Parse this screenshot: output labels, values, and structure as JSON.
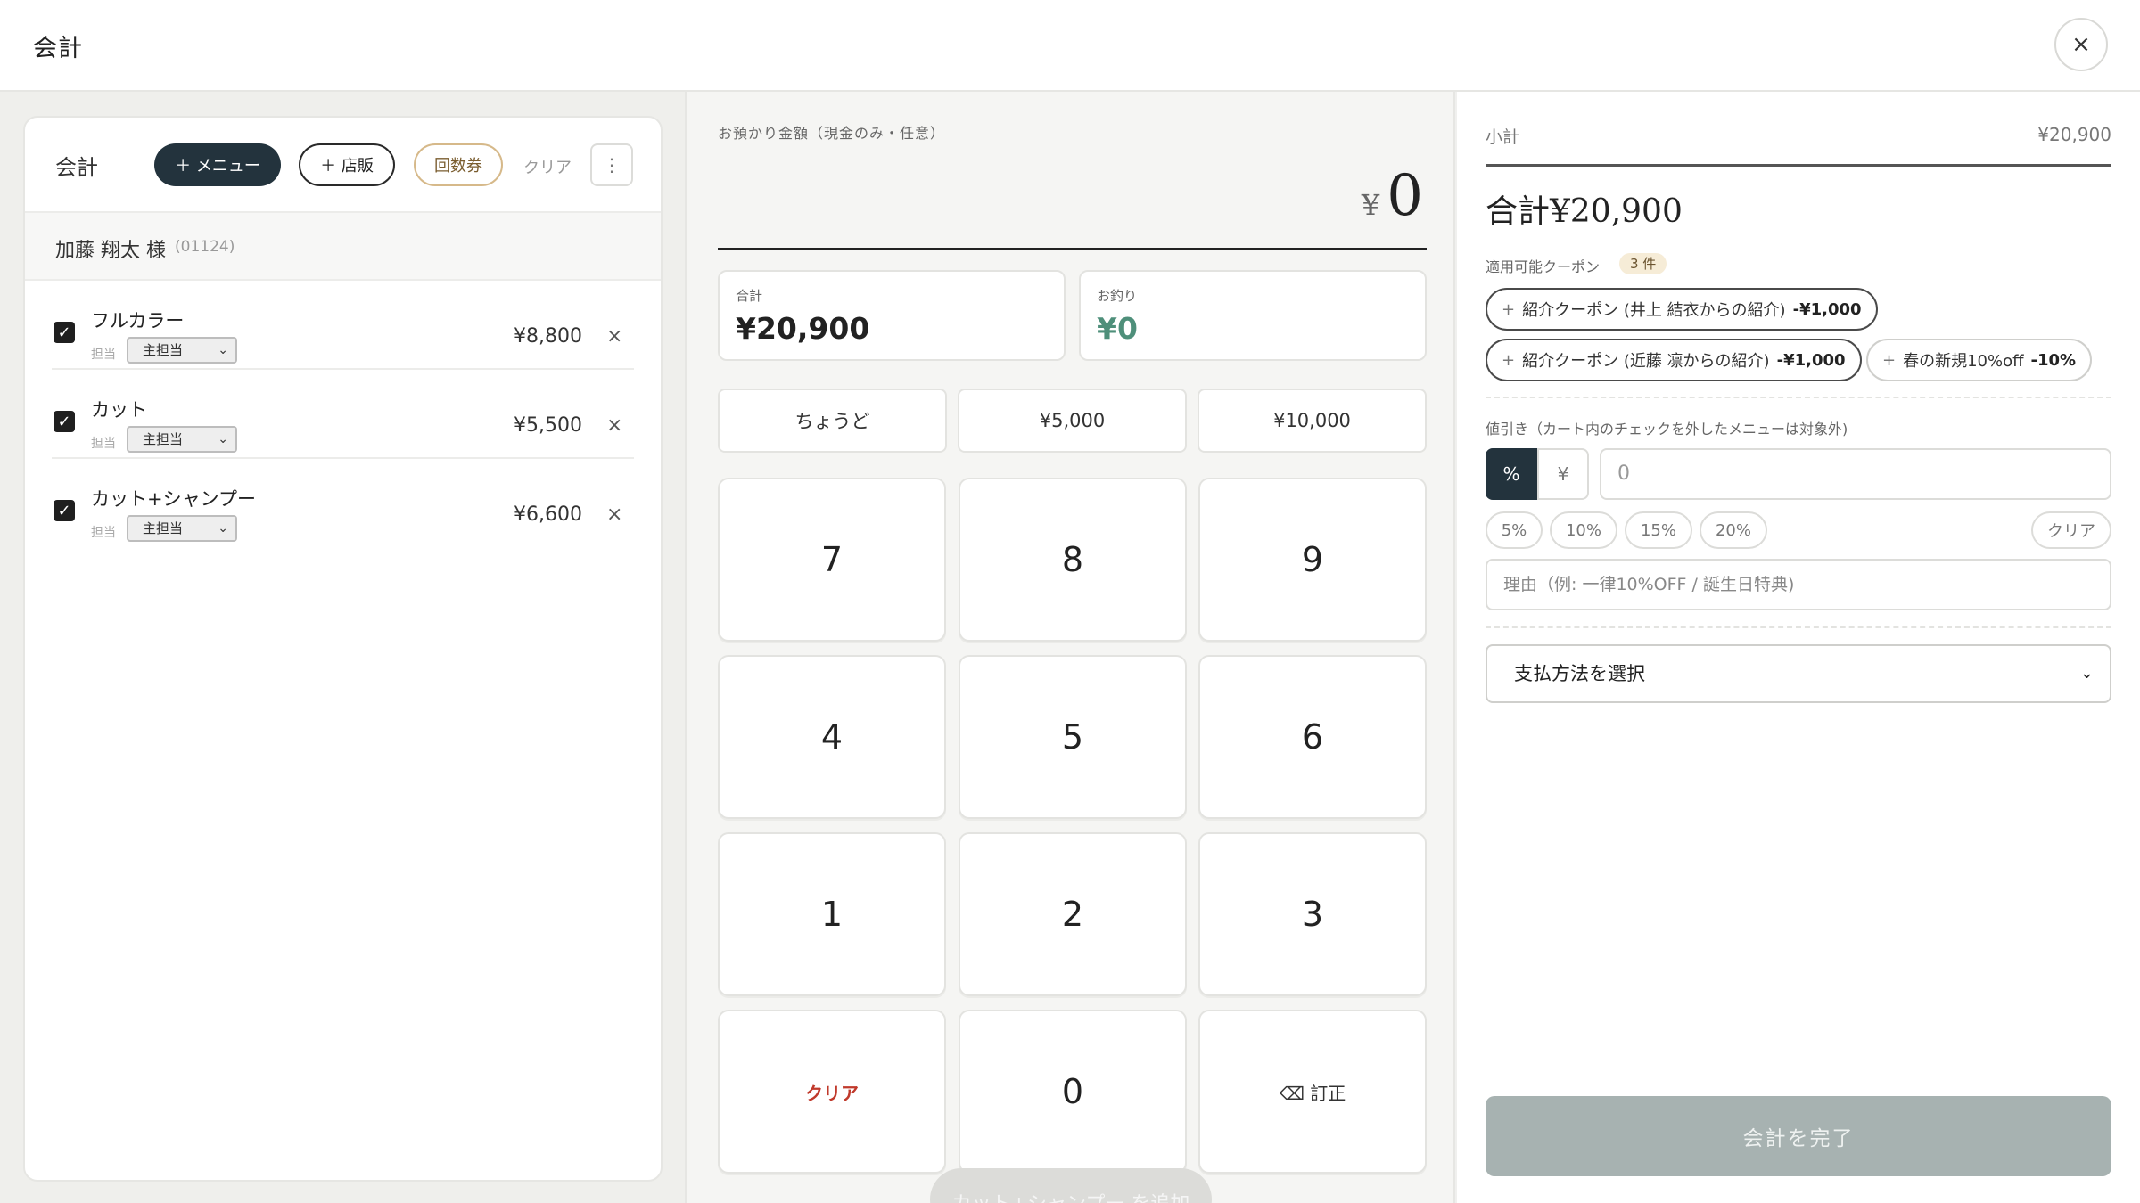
{
  "header": {
    "title": "会計",
    "close_icon": "×"
  },
  "cart": {
    "title": "会計",
    "add_menu": "＋ メニュー",
    "add_retail": "＋ 店販",
    "ticket": "回数券",
    "clear": "クリア",
    "more_icon": "⋮",
    "customer": {
      "name": "加藤 翔太 様",
      "code": "(01124)"
    },
    "items": [
      {
        "name": "フルカラー",
        "staff_label": "担当",
        "staff": "主担当",
        "price": "¥8,800",
        "checked": true
      },
      {
        "name": "カット",
        "staff_label": "担当",
        "staff": "主担当",
        "price": "¥5,500",
        "checked": true
      },
      {
        "name": "カット+シャンプー",
        "staff_label": "担当",
        "staff": "主担当",
        "price": "¥6,600",
        "checked": true
      }
    ]
  },
  "payment": {
    "received_label": "お預かり金額（現金のみ・任意）",
    "received_currency": "¥",
    "received_value": "0",
    "total_label": "合計",
    "total_value": "¥20,900",
    "change_label": "お釣り",
    "change_value": "¥0",
    "quick": [
      "ちょうど",
      "¥5,000",
      "¥10,000"
    ],
    "keys": [
      "7",
      "8",
      "9",
      "4",
      "5",
      "6",
      "1",
      "2",
      "3",
      "クリア",
      "0",
      "⌫ 訂正"
    ],
    "floating_button": "カット+シャンプー を追加"
  },
  "summary": {
    "subtotal_label": "小計",
    "subtotal_value": "¥20,900",
    "total_text": "合計¥20,900",
    "coupon_label": "適用可能クーポン",
    "coupon_count": "3 件",
    "coupons": [
      {
        "name": "紹介クーポン (井上 結衣からの紹介)",
        "amount": "-¥1,000"
      },
      {
        "name": "紹介クーポン (近藤 凛からの紹介)",
        "amount": "-¥1,000"
      },
      {
        "name": "春の新規10%off",
        "amount": "-10%"
      }
    ],
    "discount_label": "値引き（カート内のチェックを外したメニューは対象外)",
    "discount_percent": "%",
    "discount_yen": "¥",
    "discount_value": "0",
    "discount_chips": [
      "5%",
      "10%",
      "15%",
      "20%"
    ],
    "discount_clear": "クリア",
    "reason_placeholder": "理由（例: 一律10%OFF / 誕生日特典)",
    "payment_method": "支払方法を選択",
    "finish": "会計を完了"
  },
  "colors": {
    "accent_dark": "#23333d",
    "change_green": "#4e8f7a",
    "clear_red": "#c0392b",
    "finish_disabled": "#a7b2b1",
    "ticket_gold": "#d6b98a"
  }
}
